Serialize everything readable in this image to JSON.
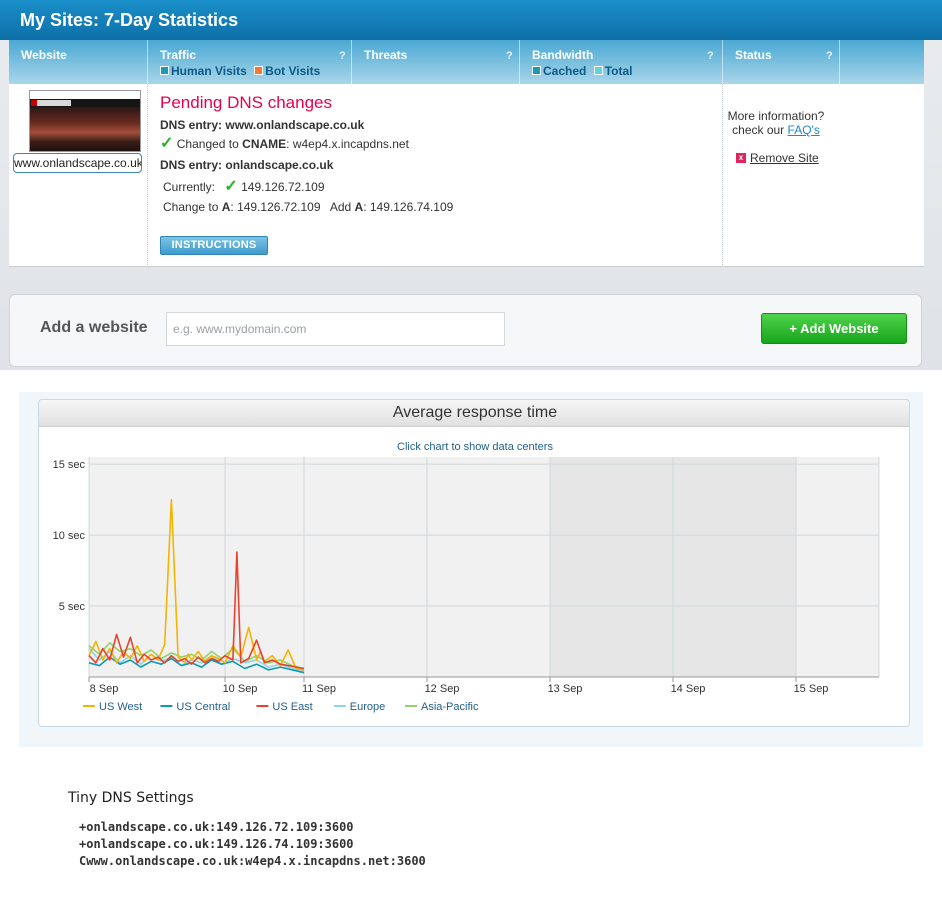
{
  "page": {
    "title": "My Sites: 7-Day Statistics"
  },
  "table": {
    "headers": {
      "website": "Website",
      "traffic": "Traffic",
      "threats": "Threats",
      "bandwidth": "Bandwidth",
      "status": "Status",
      "help": "?"
    },
    "traffic_legend": {
      "human": "Human Visits",
      "bot": "Bot Visits",
      "human_color": "#1a9bb5",
      "bot_color": "#ef7a35"
    },
    "bandwidth_legend": {
      "cached": "Cached",
      "total": "Total",
      "cached_color": "#1a9bb5",
      "total_color": "#5fd3d6"
    }
  },
  "site": {
    "url": "www.onlandscape.co.uk",
    "pending_title": "Pending DNS changes",
    "entry1_label": "DNS entry:",
    "entry1_value": "www.onlandscape.co.uk",
    "changed_to_prefix": "Changed to",
    "changed_to_type": "CNAME",
    "changed_to_value": ": w4ep4.x.incapdns.net",
    "entry2_label": "DNS entry:",
    "entry2_value": "onlandscape.co.uk",
    "currently_label": "Currently:",
    "currently_value": "149.126.72.109",
    "change_to_prefix": "Change to",
    "change_to_type": "A",
    "change_to_value": ": 149.126.72.109",
    "add_prefix": "Add",
    "add_type": "A",
    "add_value": ": 149.126.74.109",
    "instructions_label": "INSTRUCTIONS",
    "status_line1": "More information?",
    "status_line2": "check our",
    "faq_link": "FAQ's",
    "remove_label": "Remove Site"
  },
  "add_website": {
    "label": "Add a website",
    "placeholder": "e.g. www.mydomain.com",
    "button": "+ Add Website"
  },
  "chart_panel": {
    "title": "Average response time",
    "subtitle": "Click chart to show data centers"
  },
  "chart_data": {
    "type": "line",
    "title": "Average response time",
    "x_ticks": [
      "8 Sep",
      "10 Sep",
      "11 Sep",
      "12 Sep",
      "13 Sep",
      "14 Sep",
      "15 Sep"
    ],
    "y_ticks": [
      "5 sec",
      "10 sec",
      "15 sec"
    ],
    "ylim": [
      0,
      15.5
    ],
    "xlim": [
      8,
      15.5
    ],
    "grid": true,
    "legend_position": "bottom-left",
    "series": [
      {
        "name": "US West",
        "color": "#f4b400",
        "x": [
          8.0,
          8.1,
          8.2,
          8.3,
          8.4,
          8.5,
          8.6,
          8.7,
          8.8,
          8.9,
          9.0,
          9.1,
          9.2,
          9.3,
          9.4,
          9.45,
          9.5,
          9.6,
          9.7,
          9.8,
          9.9,
          10.0,
          10.1,
          10.2,
          10.3,
          10.4,
          10.45,
          10.5,
          10.6,
          10.7,
          10.8,
          10.9,
          11.0
        ],
        "y": [
          1.5,
          2.5,
          1.2,
          2.0,
          1.0,
          1.8,
          1.3,
          2.2,
          1.1,
          1.6,
          1.2,
          2.3,
          12.5,
          1.4,
          1.0,
          1.6,
          1.2,
          1.8,
          1.1,
          1.5,
          1.3,
          1.0,
          2.2,
          1.4,
          3.5,
          1.2,
          1.8,
          1.1,
          1.5,
          0.8,
          1.9,
          0.6,
          0.5
        ]
      },
      {
        "name": "US Central",
        "color": "#0e9bb0",
        "x": [
          8.0,
          8.15,
          8.3,
          8.45,
          8.6,
          8.75,
          8.9,
          9.05,
          9.2,
          9.35,
          9.5,
          9.65,
          9.8,
          9.95,
          10.1,
          10.25,
          10.4,
          10.55,
          10.7,
          10.85,
          11.0
        ],
        "y": [
          1.0,
          0.8,
          1.4,
          0.9,
          1.2,
          0.7,
          1.1,
          0.9,
          1.3,
          0.8,
          1.0,
          0.7,
          1.2,
          0.9,
          1.1,
          0.6,
          0.9,
          0.5,
          0.7,
          0.5,
          0.3
        ]
      },
      {
        "name": "US East",
        "color": "#e8432e",
        "x": [
          8.0,
          8.1,
          8.2,
          8.3,
          8.4,
          8.5,
          8.6,
          8.7,
          8.8,
          8.9,
          9.0,
          9.1,
          9.2,
          9.3,
          9.4,
          9.5,
          9.6,
          9.7,
          9.8,
          9.9,
          10.0,
          10.1,
          10.15,
          10.2,
          10.3,
          10.4,
          10.5,
          10.6,
          10.7,
          10.8,
          10.9,
          11.0
        ],
        "y": [
          1.5,
          1.0,
          2.0,
          1.2,
          3.0,
          1.4,
          2.8,
          1.0,
          1.6,
          1.2,
          1.4,
          1.0,
          1.5,
          1.1,
          1.3,
          0.9,
          1.4,
          1.0,
          1.3,
          1.1,
          1.5,
          1.2,
          8.8,
          1.0,
          1.3,
          2.6,
          1.0,
          1.2,
          0.9,
          0.8,
          0.7,
          0.6
        ]
      },
      {
        "name": "Europe",
        "color": "#8fd3f0",
        "x": [
          8.0,
          8.15,
          8.3,
          8.45,
          8.6,
          8.75,
          8.9,
          9.05,
          9.2,
          9.35,
          9.5,
          9.65,
          9.8,
          9.95,
          10.1,
          10.25,
          10.4,
          10.55,
          10.7,
          10.85,
          11.0
        ],
        "y": [
          2.0,
          1.2,
          1.8,
          1.0,
          1.5,
          0.9,
          1.6,
          1.1,
          1.4,
          0.8,
          1.2,
          1.0,
          1.5,
          0.9,
          1.3,
          1.0,
          1.2,
          0.7,
          0.9,
          0.6,
          0.4
        ]
      },
      {
        "name": "Asia-Pacific",
        "color": "#8fd36e",
        "x": [
          8.0,
          8.15,
          8.3,
          8.45,
          8.6,
          8.75,
          8.9,
          9.05,
          9.2,
          9.35,
          9.5,
          9.65,
          9.8,
          9.95,
          10.1,
          10.25,
          10.4,
          10.55,
          10.7,
          10.85,
          11.0
        ],
        "y": [
          2.2,
          1.6,
          2.4,
          1.8,
          2.0,
          1.5,
          1.9,
          1.3,
          1.7,
          1.4,
          1.6,
          1.2,
          1.8,
          1.3,
          2.0,
          1.1,
          1.5,
          1.0,
          1.2,
          0.8,
          0.6
        ]
      }
    ]
  },
  "dns_settings": {
    "title": "Tiny DNS Settings",
    "lines": [
      "+onlandscape.co.uk:149.126.72.109:3600",
      "+onlandscape.co.uk:149.126.74.109:3600",
      "Cwww.onlandscape.co.uk:w4ep4.x.incapdns.net:3600"
    ]
  }
}
